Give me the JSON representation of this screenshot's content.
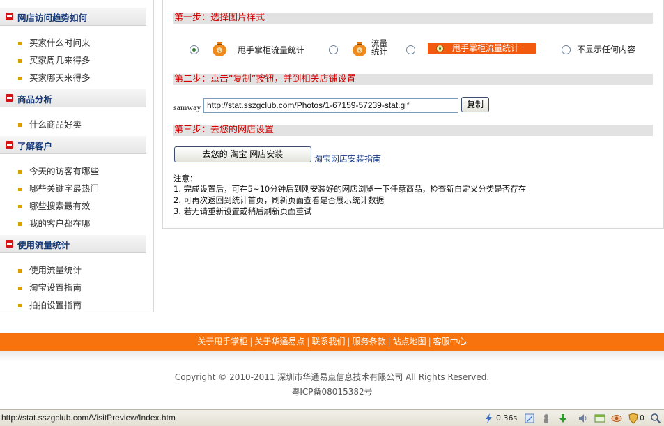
{
  "sidebar": {
    "sections": [
      {
        "title": "网店访问趋势如何",
        "items": [
          "买家什么时间来",
          "买家周几来得多",
          "买家哪天来得多"
        ]
      },
      {
        "title": "商品分析",
        "items": [
          "什么商品好卖"
        ]
      },
      {
        "title": "了解客户",
        "items": [
          "今天的访客有哪些",
          "哪些关键字最热门",
          "哪些搜索最有效",
          "我的客户都在哪"
        ]
      },
      {
        "title": "使用流量统计",
        "items": [
          "使用流量统计",
          "淘宝设置指南",
          "拍拍设置指南"
        ]
      }
    ]
  },
  "main": {
    "step1": {
      "title": "第一步：选择图片样式",
      "options": [
        {
          "label": "甩手掌柜流量统计",
          "checked": true,
          "icon": "money-bag-icon"
        },
        {
          "label_line1": "流量",
          "label_line2": "统计",
          "checked": false,
          "icon": "money-bag-icon"
        },
        {
          "label": "甩手掌柜流量统计",
          "checked": false,
          "style": "orange-banner"
        },
        {
          "label": "不显示任何内容",
          "checked": false
        }
      ]
    },
    "step2": {
      "title": "第二步：点击“复制”按钮，并到相关店铺设置",
      "field_label": "samway",
      "url_value": "http://stat.sszgclub.com/Photos/1-67159-57239-stat.gif",
      "copy_button": "复制"
    },
    "step3": {
      "title": "第三步：去您的网店设置",
      "install_button": "去您的 淘宝 网店安装",
      "guide_link": "淘宝网店安装指南"
    },
    "notes": {
      "heading": "注意：",
      "lines": [
        "1. 完成设置后，可在5~10分钟后到刚安装好的网店浏览一下任意商品，检查新自定义分类是否存在",
        "2. 可再次返回到统计首页，刷新页面查看是否展示统计数据",
        "3. 若无请重新设置或稍后刷新页面重试"
      ]
    }
  },
  "footer": {
    "links": [
      "关于甩手掌柜",
      "关于华通易点",
      "联系我们",
      "服务条款",
      "站点地图",
      "客服中心"
    ],
    "copyright": "Copyright © 2010-2011 深圳市华通易点信息技术有限公司  All Rights Reserved.",
    "icp": "粤ICP备08015382号"
  },
  "statusbar": {
    "url": "http://stat.sszgclub.com/VisitPreview/Index.htm",
    "load_time": "0.36s",
    "count": "0"
  },
  "colors": {
    "accent_orange": "#f7730d",
    "step_title_red": "#d40000",
    "sidebar_title_blue": "#173a78"
  }
}
